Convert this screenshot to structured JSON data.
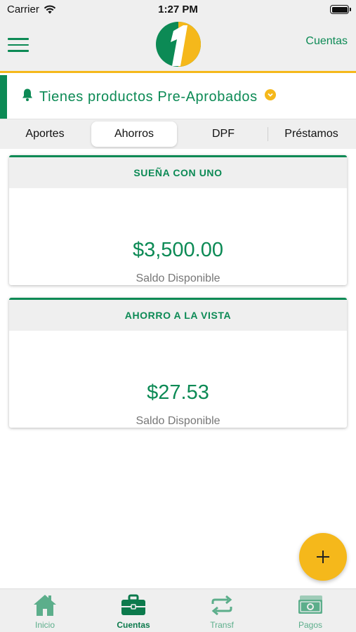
{
  "status_bar": {
    "carrier": "Carrier",
    "time": "1:27 PM"
  },
  "header": {
    "right_link": "Cuentas",
    "logo_icon": "number-one-logo",
    "menu_icon": "hamburger-menu-icon"
  },
  "banner": {
    "text": "Tienes productos Pre-Aprobados",
    "icon": "bell-icon",
    "expand_icon": "chevron-down-icon"
  },
  "tabs": [
    {
      "label": "Aportes",
      "active": false
    },
    {
      "label": "Ahorros",
      "active": true
    },
    {
      "label": "DPF",
      "active": false
    },
    {
      "label": "Préstamos",
      "active": false
    }
  ],
  "accounts": [
    {
      "name": "SUEÑA CON UNO",
      "amount": "$3,500.00",
      "label": "Saldo Disponible"
    },
    {
      "name": "AHORRO A LA VISTA",
      "amount": "$27.53",
      "label": "Saldo Disponible"
    }
  ],
  "fab": {
    "icon": "plus-icon"
  },
  "bottom_nav": [
    {
      "label": "Inicio",
      "icon": "home-icon",
      "active": false
    },
    {
      "label": "Cuentas",
      "icon": "briefcase-icon",
      "active": true
    },
    {
      "label": "Transf",
      "icon": "transfer-arrows-icon",
      "active": false
    },
    {
      "label": "Pagos",
      "icon": "money-bill-icon",
      "active": false
    }
  ],
  "colors": {
    "brand_green": "#0c8a55",
    "brand_yellow": "#f5b81b",
    "header_bg": "#efefef"
  }
}
